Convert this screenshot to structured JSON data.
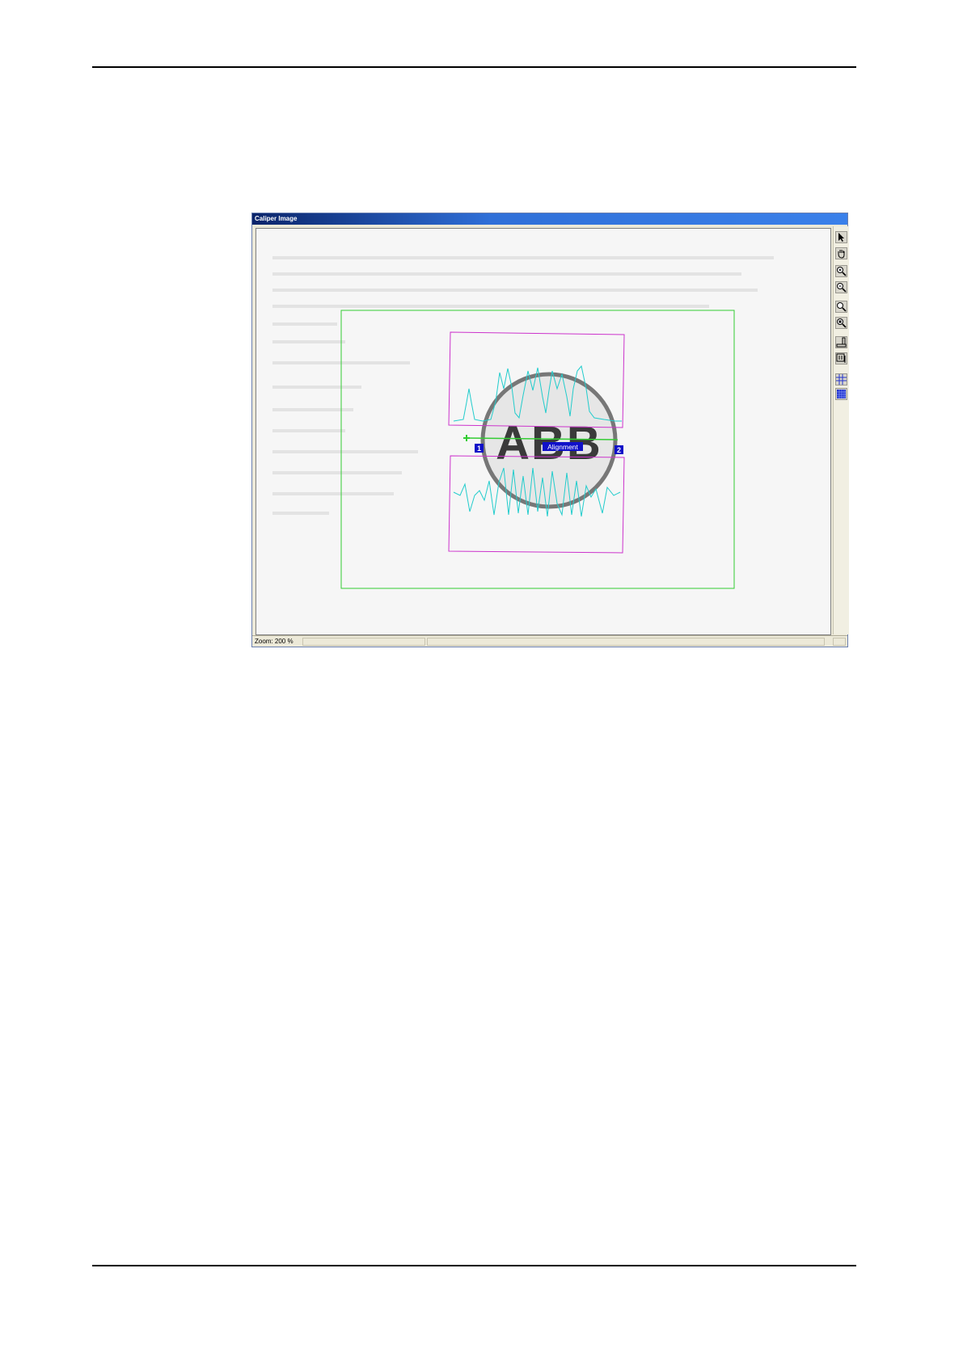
{
  "window": {
    "title": "Caliper Image",
    "status_zoom": "Zoom: 200 %"
  },
  "overlay": {
    "search_region_color": "#33cc33",
    "caliper_box_color": "#cc33cc",
    "edge_profile_color": "#22cccc",
    "label_color": "#1010c8",
    "logo_text": "ABB",
    "alignment_label": "Alignment",
    "caliper_1_label": "1",
    "caliper_2_label": "2"
  },
  "toolbar": {
    "tools": [
      {
        "name": "pointer-icon"
      },
      {
        "name": "pan-hand-icon"
      },
      {
        "name": "zoom-in-icon"
      },
      {
        "name": "zoom-out-icon"
      },
      {
        "name": "zoom-fit-icon"
      },
      {
        "name": "zoom-actual-icon"
      },
      {
        "name": "ruler-icon"
      },
      {
        "name": "measure-icon"
      },
      {
        "name": "grid-icon"
      },
      {
        "name": "grid-dense-icon"
      }
    ]
  }
}
